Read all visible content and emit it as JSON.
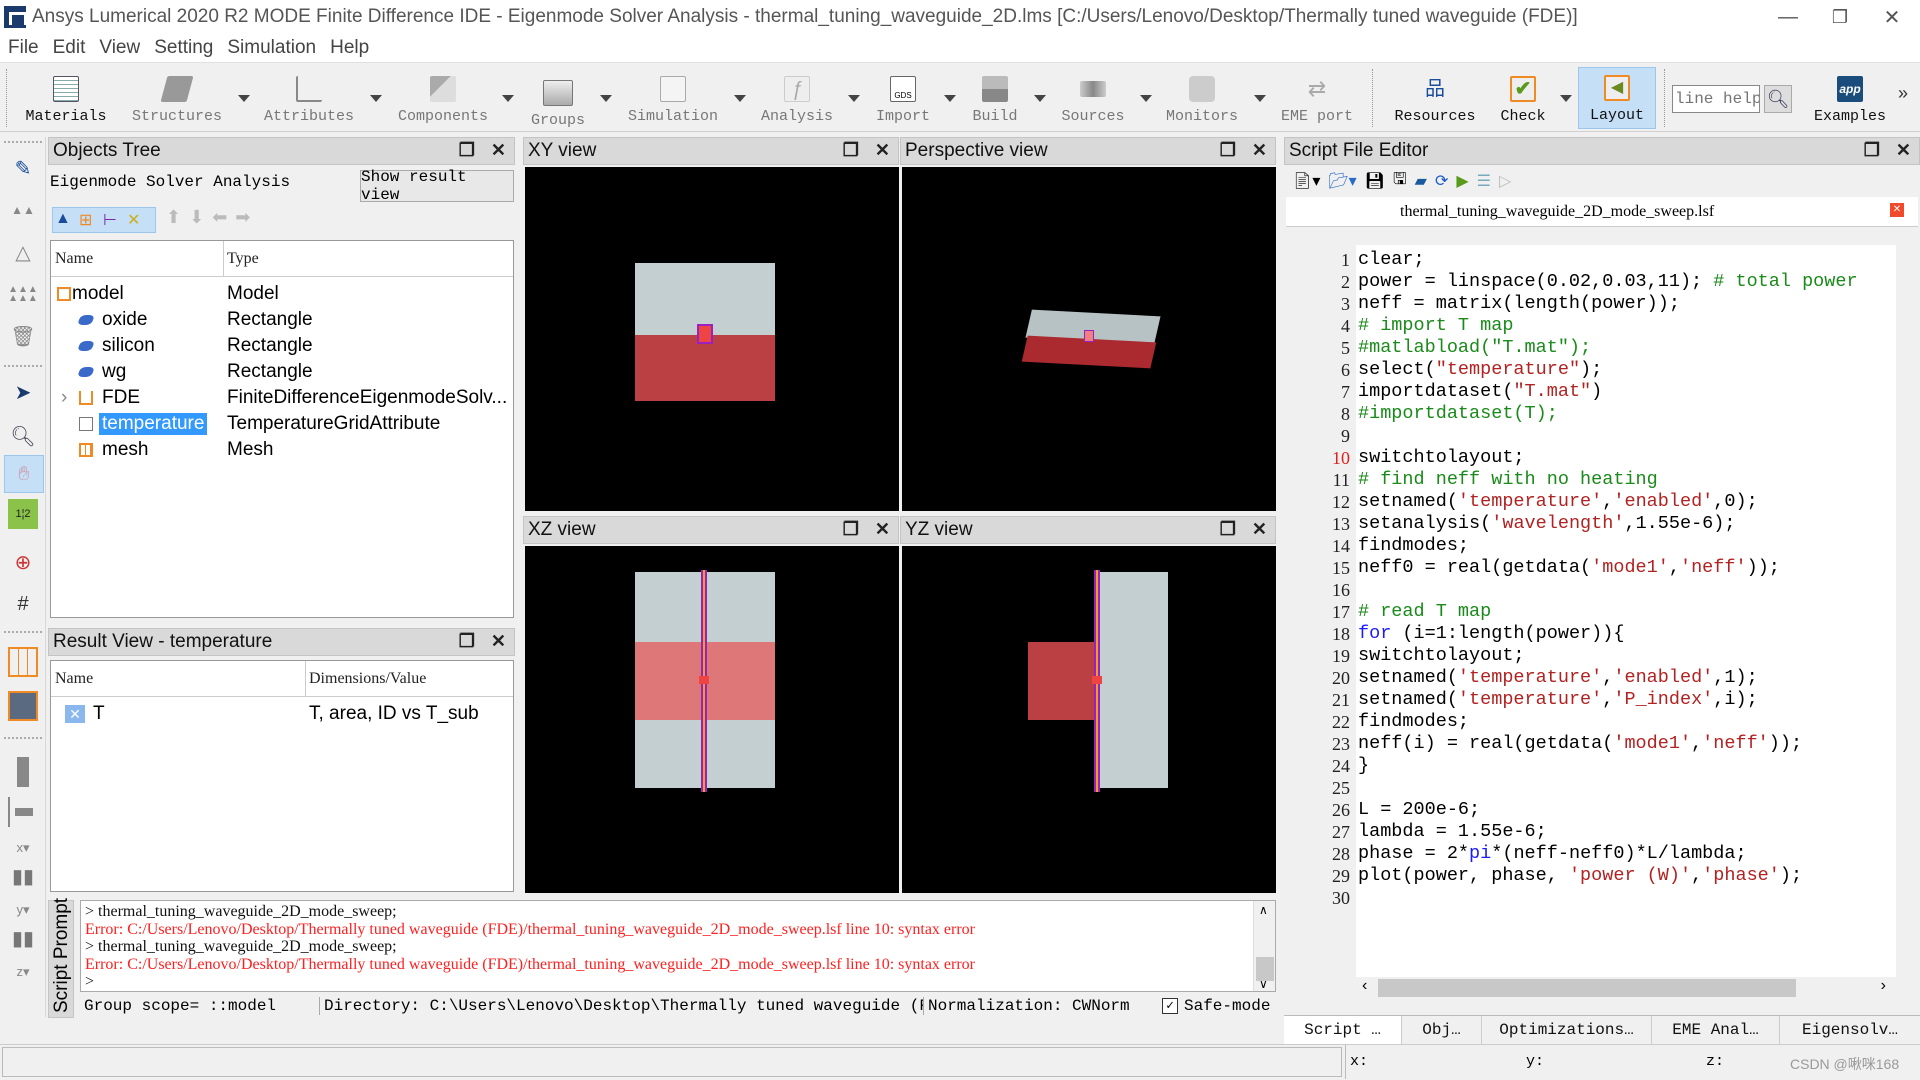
{
  "window": {
    "title": "Ansys Lumerical 2020 R2 MODE Finite Difference IDE - Eigenmode Solver Analysis - thermal_tuning_waveguide_2D.lms [C:/Users/Lenovo/Desktop/Thermally tuned waveguide (FDE)]",
    "minimize": "—",
    "restore": "❐",
    "close": "✕"
  },
  "menu": [
    "File",
    "Edit",
    "View",
    "Setting",
    "Simulation",
    "Help"
  ],
  "toolbar": {
    "items": [
      {
        "label": "Materials",
        "icon": "materials-icon"
      },
      {
        "label": "Structures",
        "icon": "structures-icon"
      },
      {
        "label": "Attributes",
        "icon": "attributes-icon"
      },
      {
        "label": "Components",
        "icon": "components-icon"
      },
      {
        "label": "Groups",
        "icon": "groups-icon"
      },
      {
        "label": "Simulation",
        "icon": "simulation-icon"
      },
      {
        "label": "Analysis",
        "icon": "analysis-icon"
      },
      {
        "label": "Import",
        "icon": "gds-import-icon"
      },
      {
        "label": "Build",
        "icon": "build-icon"
      },
      {
        "label": "Sources",
        "icon": "sources-icon"
      },
      {
        "label": "Monitors",
        "icon": "monitors-icon"
      },
      {
        "label": "EME port",
        "icon": "eme-port-icon"
      },
      {
        "label": "Resources",
        "icon": "resources-icon"
      },
      {
        "label": "Check",
        "icon": "check-icon"
      },
      {
        "label": "Layout",
        "icon": "layout-icon"
      },
      {
        "label": "Examples",
        "icon": "examples-icon"
      }
    ],
    "help_placeholder": "line help",
    "examples_badge": "app",
    "more": "»"
  },
  "objects_tree": {
    "title": "Objects Tree",
    "subtitle": "Eigenmode Solver Analysis",
    "show_result_button": "Show result view",
    "columns": [
      "Name",
      "Type"
    ],
    "rows": [
      {
        "name": "model",
        "type": "Model",
        "icon": "model-icon",
        "indent": 0
      },
      {
        "name": "oxide",
        "type": "Rectangle",
        "icon": "rectangle-icon",
        "indent": 1
      },
      {
        "name": "silicon",
        "type": "Rectangle",
        "icon": "rectangle-icon",
        "indent": 1
      },
      {
        "name": "wg",
        "type": "Rectangle",
        "icon": "rectangle-icon",
        "indent": 1
      },
      {
        "name": "FDE",
        "type": "FiniteDifferenceEigenmodeSolv...",
        "icon": "fde-icon",
        "indent": 1,
        "expandable": true
      },
      {
        "name": "temperature",
        "type": "TemperatureGridAttribute",
        "icon": "temperature-grid-icon",
        "indent": 1,
        "selected": true
      },
      {
        "name": "mesh",
        "type": "Mesh",
        "icon": "mesh-icon",
        "indent": 1
      }
    ]
  },
  "result_view": {
    "title": "Result View - temperature",
    "columns": [
      "Name",
      "Dimensions/Value"
    ],
    "rows": [
      {
        "name": "T",
        "value": "T, area, ID vs T_sub"
      }
    ]
  },
  "viewports": {
    "xy": "XY view",
    "perspective": "Perspective view",
    "xz": "XZ view",
    "yz": "YZ view"
  },
  "script_prompt": {
    "tab_label": "Script Prompt",
    "lines": [
      {
        "type": "cmd",
        "text": "> thermal_tuning_waveguide_2D_mode_sweep;"
      },
      {
        "type": "error",
        "text": "Error: C:/Users/Lenovo/Desktop/Thermally tuned waveguide (FDE)/thermal_tuning_waveguide_2D_mode_sweep.lsf line 10: syntax error"
      },
      {
        "type": "cmd",
        "text": "> thermal_tuning_waveguide_2D_mode_sweep;"
      },
      {
        "type": "error",
        "text": "Error: C:/Users/Lenovo/Desktop/Thermally tuned waveguide (FDE)/thermal_tuning_waveguide_2D_mode_sweep.lsf line 10: syntax error"
      },
      {
        "type": "cmd",
        "text": ">"
      }
    ],
    "status": {
      "group_scope": "Group scope= ::model",
      "directory": "Directory: C:\\Users\\Lenovo\\Desktop\\Thermally tuned waveguide (FDE)",
      "normalization": "Normalization: CWNorm",
      "safe_mode_label": "Safe-mode",
      "safe_mode_checked": true
    }
  },
  "script_editor": {
    "title": "Script File Editor",
    "file_tab": "thermal_tuning_waveguide_2D_mode_sweep.lsf",
    "error_line": 10,
    "lines": [
      [
        {
          "t": "clear;"
        }
      ],
      [
        {
          "t": "power = linspace(0.02,0.03,11); "
        },
        {
          "t": "# total power",
          "c": "com"
        }
      ],
      [
        {
          "t": "neff = matrix(length(power));"
        }
      ],
      [
        {
          "t": "# import T map",
          "c": "com"
        }
      ],
      [
        {
          "t": "#matlabload(\"T.mat\");",
          "c": "com"
        }
      ],
      [
        {
          "t": "select("
        },
        {
          "t": "\"temperature\"",
          "c": "str"
        },
        {
          "t": ");"
        }
      ],
      [
        {
          "t": "importdataset("
        },
        {
          "t": "\"T.mat\"",
          "c": "str"
        },
        {
          "t": ")"
        }
      ],
      [
        {
          "t": "#importdataset(T);",
          "c": "com"
        }
      ],
      [
        {
          "t": ""
        }
      ],
      [
        {
          "t": "switchtolayout;"
        }
      ],
      [
        {
          "t": "# find neff with no heating",
          "c": "com"
        }
      ],
      [
        {
          "t": "setnamed("
        },
        {
          "t": "'temperature'",
          "c": "str"
        },
        {
          "t": ","
        },
        {
          "t": "'enabled'",
          "c": "str"
        },
        {
          "t": ",0);"
        }
      ],
      [
        {
          "t": "setanalysis("
        },
        {
          "t": "'wavelength'",
          "c": "str"
        },
        {
          "t": ",1.55e-6);"
        }
      ],
      [
        {
          "t": "findmodes;"
        }
      ],
      [
        {
          "t": "neff0 = real(getdata("
        },
        {
          "t": "'mode1'",
          "c": "str"
        },
        {
          "t": ","
        },
        {
          "t": "'neff'",
          "c": "str"
        },
        {
          "t": "));"
        }
      ],
      [
        {
          "t": ""
        }
      ],
      [
        {
          "t": "# read T map",
          "c": "com"
        }
      ],
      [
        {
          "t": "for",
          "c": "kw"
        },
        {
          "t": " (i=1:length(power)){"
        }
      ],
      [
        {
          "t": "switchtolayout;"
        }
      ],
      [
        {
          "t": "setnamed("
        },
        {
          "t": "'temperature'",
          "c": "str"
        },
        {
          "t": ","
        },
        {
          "t": "'enabled'",
          "c": "str"
        },
        {
          "t": ",1);"
        }
      ],
      [
        {
          "t": "setnamed("
        },
        {
          "t": "'temperature'",
          "c": "str"
        },
        {
          "t": ","
        },
        {
          "t": "'P_index'",
          "c": "str"
        },
        {
          "t": ",i);"
        }
      ],
      [
        {
          "t": "findmodes;"
        }
      ],
      [
        {
          "t": "neff(i) = real(getdata("
        },
        {
          "t": "'mode1'",
          "c": "str"
        },
        {
          "t": ","
        },
        {
          "t": "'neff'",
          "c": "str"
        },
        {
          "t": "));"
        }
      ],
      [
        {
          "t": "}"
        }
      ],
      [
        {
          "t": ""
        }
      ],
      [
        {
          "t": "L = 200e-6;"
        }
      ],
      [
        {
          "t": "lambda = 1.55e-6;"
        }
      ],
      [
        {
          "t": "phase = 2*"
        },
        {
          "t": "pi",
          "c": "kw"
        },
        {
          "t": "*(neff-neff0)*L/lambda;"
        }
      ],
      [
        {
          "t": "plot(power, phase, "
        },
        {
          "t": "'power (W)'",
          "c": "str"
        },
        {
          "t": ","
        },
        {
          "t": "'phase'",
          "c": "str"
        },
        {
          "t": ");"
        }
      ],
      [
        {
          "t": ""
        }
      ]
    ]
  },
  "bottom_tabs": [
    "Script …",
    "Obj…",
    "Optimizations…",
    "EME Anal…",
    "Eigensolv…"
  ],
  "coords": {
    "x": "x:",
    "y": "y:",
    "z": "z:"
  },
  "watermark": "CSDN @啾咪168",
  "colors": {
    "oxide": "#c4cfd1",
    "silicon": "#bb4044",
    "wg_highlight": "#de7878",
    "selection": "#3399ff",
    "error": "#ff2020"
  }
}
